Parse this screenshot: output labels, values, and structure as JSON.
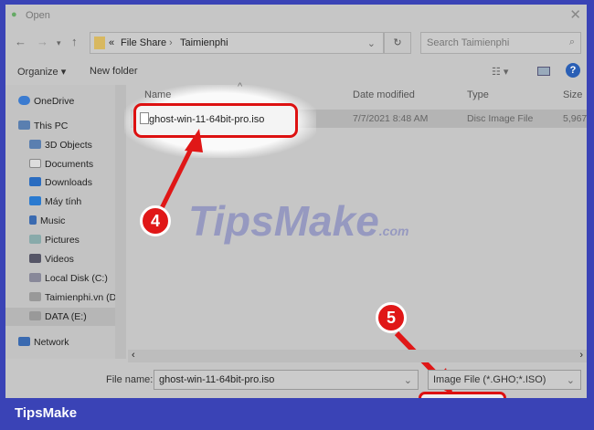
{
  "window": {
    "title": "Open",
    "close": "✕"
  },
  "address": {
    "prefix": "«",
    "path": [
      "File Share",
      "Taimienphi"
    ],
    "separator": "›",
    "search_placeholder": "Search Taimienphi"
  },
  "toolbar": {
    "organize": "Organize ▾",
    "new_folder": "New folder",
    "view": "☷ ▾",
    "help": "?"
  },
  "sidebar": {
    "items": [
      "OneDrive",
      "This PC",
      "3D Objects",
      "Documents",
      "Downloads",
      "Máy tính",
      "Music",
      "Pictures",
      "Videos",
      "Local Disk (C:)",
      "Taimienphi.vn (D",
      "DATA (E:)",
      "Network"
    ]
  },
  "columns": {
    "name": "Name",
    "date": "Date modified",
    "type": "Type",
    "size": "Size"
  },
  "file": {
    "name": "ghost-win-11-64bit-pro.iso",
    "date": "7/7/2021 8:48 AM",
    "type": "Disc Image File",
    "size": "5,967,"
  },
  "bottom": {
    "file_name_label": "File name:",
    "file_name_value": "ghost-win-11-64bit-pro.iso",
    "file_type": "Image File (*.GHO;*.ISO)"
  },
  "callouts": {
    "step4": "4",
    "step5": "5"
  },
  "watermark": {
    "main": "TipsMake",
    "suffix": ".com"
  },
  "brand": "TipsMake"
}
